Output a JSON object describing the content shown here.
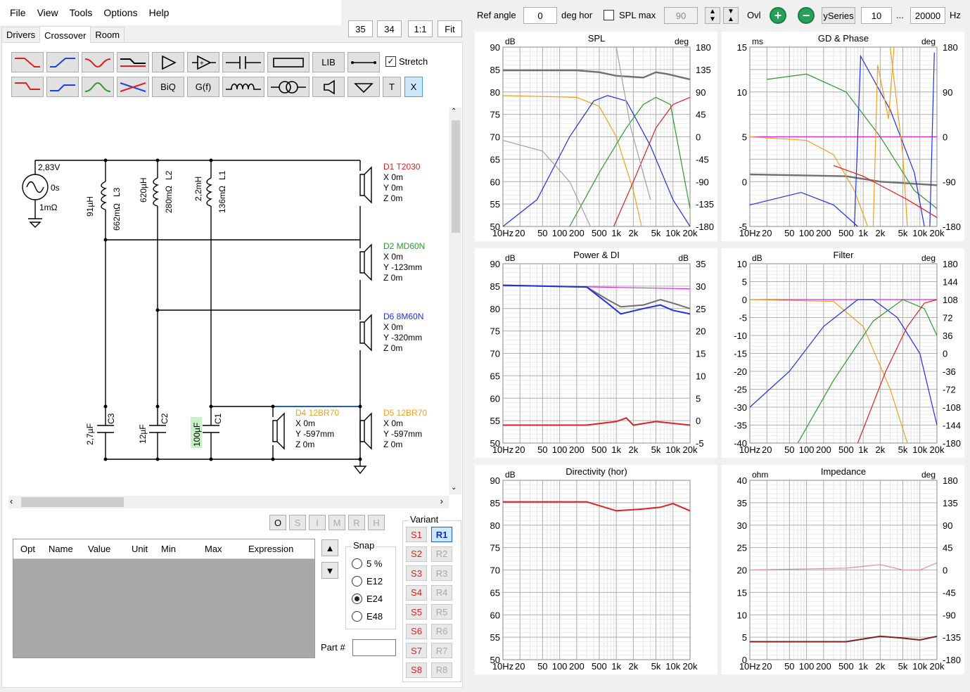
{
  "menu": [
    "File",
    "View",
    "Tools",
    "Options",
    "Help"
  ],
  "tabs": [
    "Drivers",
    "Crossover",
    "Room"
  ],
  "view_buttons": [
    "35",
    "34",
    "1:1",
    "Fit"
  ],
  "toolbar": {
    "lib": "LIB",
    "stretch": "Stretch",
    "biq": "BiQ",
    "gf": "G(f)",
    "t": "T",
    "x": "X"
  },
  "topbar": {
    "ref_angle_label": "Ref angle",
    "ref_angle_value": "0",
    "deg_hor": "deg hor",
    "spl_max": "SPL max",
    "spl_max_value": "90",
    "ovl": "Ovl",
    "yseries": "ySeries",
    "freq_min": "10",
    "dots": "...",
    "freq_max": "20000",
    "hz": "Hz"
  },
  "schematic": {
    "source": {
      "voltage": "2,83V",
      "delay": "0s",
      "resistance": "1mΩ"
    },
    "inductors": [
      {
        "value": "91µH",
        "res": "662mΩ",
        "name": "L3"
      },
      {
        "value": "620µH",
        "res": "280mΩ",
        "name": "L2"
      },
      {
        "value": "2,2mH",
        "res": "136mΩ",
        "name": "L1"
      }
    ],
    "capacitors": [
      {
        "value": "2,7µF",
        "name": "C3"
      },
      {
        "value": "12µF",
        "name": "C2"
      },
      {
        "value": "100µF",
        "name": "C1"
      }
    ],
    "drivers": [
      {
        "name": "D1 T2030",
        "x": "X 0m",
        "y": "Y 0m",
        "z": "Z 0m",
        "color": "#e02020"
      },
      {
        "name": "D2 MD60N",
        "x": "X 0m",
        "y": "Y -123mm",
        "z": "Z 0m",
        "color": "#2a9a2a"
      },
      {
        "name": "D6 8M60N",
        "x": "X 0m",
        "y": "Y -320mm",
        "z": "Z 0m",
        "color": "#2030e0"
      },
      {
        "name": "D4 12BR70",
        "x": "X 0m",
        "y": "Y -597mm",
        "z": "Z 0m",
        "color": "#f0a020"
      },
      {
        "name": "D5 12BR70",
        "x": "X 0m",
        "y": "Y -597mm",
        "z": "Z 0m",
        "color": "#f0a020"
      }
    ]
  },
  "opt_buttons": [
    "O",
    "S",
    "I",
    "M",
    "R",
    "H"
  ],
  "table_headers": [
    "Opt",
    "Name",
    "Value",
    "Unit",
    "Min",
    "Max",
    "Expression"
  ],
  "snap": {
    "label": "Snap",
    "options": [
      "5 %",
      "E12",
      "E24",
      "E48"
    ],
    "selected": "E24"
  },
  "part_label": "Part #",
  "variant": {
    "label": "Variant",
    "s": [
      "S1",
      "S2",
      "S3",
      "S4",
      "S5",
      "S6",
      "S7",
      "S8"
    ],
    "r": [
      "R1",
      "R2",
      "R3",
      "R4",
      "R5",
      "R6",
      "R7",
      "R8"
    ],
    "active_r": "R1"
  },
  "x_ticks": [
    "10Hz",
    "20",
    "50",
    "100",
    "200",
    "500",
    "1k",
    "2k",
    "5k",
    "10k",
    "20k"
  ],
  "charts": [
    {
      "title": "SPL",
      "left_unit": "dB",
      "right_unit": "deg",
      "left": [
        "90",
        "85",
        "80",
        "75",
        "70",
        "65",
        "60",
        "55",
        "50"
      ],
      "right": [
        "180",
        "135",
        "90",
        "45",
        "0",
        "-45",
        "-90",
        "-135",
        "-180"
      ]
    },
    {
      "title": "GD & Phase",
      "left_unit": "ms",
      "right_unit": "deg",
      "left": [
        "15",
        "",
        "10",
        "",
        "5",
        "",
        "0",
        "",
        "-5"
      ],
      "right": [
        "180",
        "",
        "90",
        "",
        "0",
        "",
        "-90",
        "",
        "-180"
      ]
    },
    {
      "title": "Power & DI",
      "left_unit": "dB",
      "right_unit": "dB",
      "left": [
        "90",
        "85",
        "80",
        "75",
        "70",
        "65",
        "60",
        "55",
        "50"
      ],
      "right": [
        "35",
        "30",
        "25",
        "20",
        "15",
        "10",
        "5",
        "0",
        "-5"
      ]
    },
    {
      "title": "Filter",
      "left_unit": "dB",
      "right_unit": "deg",
      "left": [
        "10",
        "5",
        "0",
        "-5",
        "-10",
        "-15",
        "-20",
        "-25",
        "-30",
        "-35",
        "-40"
      ],
      "right": [
        "180",
        "144",
        "108",
        "72",
        "36",
        "0",
        "-36",
        "-72",
        "-108",
        "-144",
        "-180"
      ]
    },
    {
      "title": "Directivity (hor)",
      "left_unit": "dB",
      "right_unit": "",
      "left": [
        "90",
        "85",
        "80",
        "75",
        "70",
        "65",
        "60",
        "55",
        "50"
      ],
      "right": []
    },
    {
      "title": "Impedance",
      "left_unit": "ohm",
      "right_unit": "deg",
      "left": [
        "40",
        "35",
        "30",
        "25",
        "20",
        "15",
        "10",
        "5",
        "0"
      ],
      "right": [
        "180",
        "135",
        "90",
        "45",
        "0",
        "-45",
        "-90",
        "-135",
        "-180"
      ]
    }
  ]
}
